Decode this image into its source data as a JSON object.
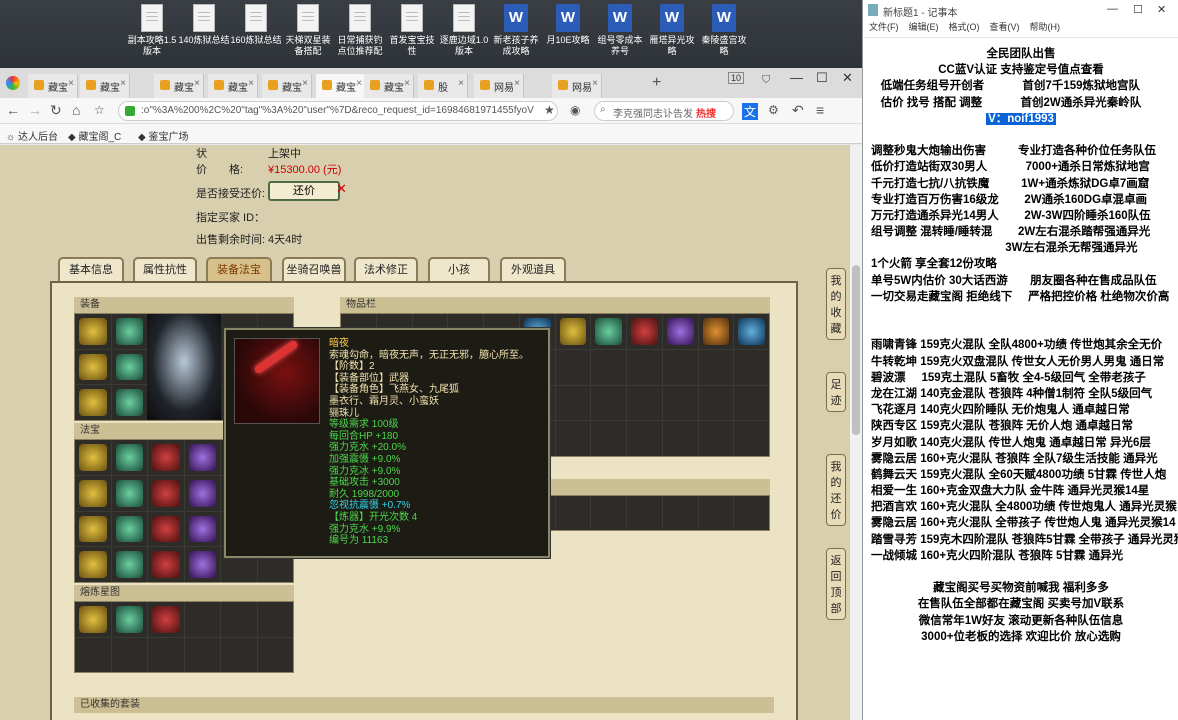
{
  "desktop_icons": [
    {
      "label": "副本攻略1.5\n版本",
      "type": "doc"
    },
    {
      "label": "140炼狱总结",
      "type": "doc"
    },
    {
      "label": "160炼狱总结",
      "type": "doc"
    },
    {
      "label": "天梯双星装\n备搭配",
      "type": "doc"
    },
    {
      "label": "日常捕获钓\n点位推荐配",
      "type": "doc"
    },
    {
      "label": "首发宝宝技\n性",
      "type": "doc"
    },
    {
      "label": "逐鹿边域1.0\n版本",
      "type": "doc"
    },
    {
      "label": "新老孩子养\n成攻略",
      "type": "word"
    },
    {
      "label": "月10E攻略",
      "type": "word"
    },
    {
      "label": "组号零成本\n养号",
      "type": "word"
    },
    {
      "label": "雁塔异光攻\n略",
      "type": "word"
    },
    {
      "label": "秦陵盛宫攻\n略",
      "type": "word"
    }
  ],
  "browser": {
    "tabs": [
      {
        "label": "藏宝"
      },
      {
        "label": "藏宝"
      },
      {
        "label": "藏宝"
      },
      {
        "label": "藏宝"
      },
      {
        "label": "藏宝"
      },
      {
        "label": "藏宝",
        "active": true
      },
      {
        "label": "藏宝"
      },
      {
        "label": "股"
      },
      {
        "label": "网易"
      },
      {
        "label": "网易"
      }
    ],
    "tab_count": "10",
    "url": ":o\"%3A%200%2C%20\"tag\"%3A%20\"user\"%7D&reco_request_id=16984681971455fyoV",
    "search_placeholder": "李克强同志讣告发",
    "search_hot": "热搜",
    "bookmarks": [
      "达人后台",
      "藏宝阁_C",
      "鉴宝广场"
    ]
  },
  "item_info": {
    "status_label": "状",
    "status_value": "上架中",
    "price_label": "价　　格:",
    "price_value": "¥15300.00 (元)",
    "counteroffer_label": "是否接受还价:",
    "counteroffer_button": "还价",
    "buyer_label": "指定买家 ID：",
    "remaining_label": "出售剩余时间:",
    "remaining_value": "4天4时"
  },
  "nav_tabs": [
    {
      "label": "基本信息"
    },
    {
      "label": "属性抗性"
    },
    {
      "label": "装备法宝",
      "active": true
    },
    {
      "label": "坐骑召唤兽"
    },
    {
      "label": "法术修正"
    },
    {
      "label": "小孩"
    },
    {
      "label": "外观道具"
    }
  ],
  "sections": {
    "equipment": "装备",
    "treasure": "法宝",
    "talisman": "熔炼星图",
    "inventory": "物品栏",
    "collected": "已收集的套装"
  },
  "side_buttons": [
    "我的收藏",
    "足迹",
    "我的还价",
    "返回顶部"
  ],
  "tooltip": {
    "lines": [
      {
        "text": "暗夜",
        "color": "yellow"
      },
      {
        "text": "索魂勾命，暗夜无声，无正无邪，臆心所至。",
        "color": "white"
      },
      {
        "text": "【阶数】2",
        "color": "white"
      },
      {
        "text": "【装备部位】武器",
        "color": "white"
      },
      {
        "text": "【装备角色】飞燕女、九尾狐",
        "color": "white"
      },
      {
        "text": "墨衣行、霜月灵、小蛮妖",
        "color": "white"
      },
      {
        "text": "骊珠儿",
        "color": "white"
      },
      {
        "text": "等级需求 100级",
        "color": "green"
      },
      {
        "text": "每回合HP +180",
        "color": "green"
      },
      {
        "text": "强力克水 +20.0%",
        "color": "green"
      },
      {
        "text": "加强震慑 +9.0%",
        "color": "green"
      },
      {
        "text": "强力克冰 +9.0%",
        "color": "green"
      },
      {
        "text": "基础攻击 +3000",
        "color": "green"
      },
      {
        "text": "耐久 1998/2000",
        "color": "green"
      },
      {
        "text": "忽视抗震慑 +0.7%",
        "color": "cyan"
      },
      {
        "text": " ",
        "color": "white"
      },
      {
        "text": "【炼器】开光次数 4",
        "color": "green"
      },
      {
        "text": "强力克水 +9.9%",
        "color": "green"
      },
      {
        "text": " ",
        "color": "white"
      },
      {
        "text": "编号为 11163",
        "color": "green"
      }
    ]
  },
  "notepad": {
    "title": "新标题1 - 记事本",
    "menu": [
      "文件(F)",
      "编辑(E)",
      "格式(O)",
      "查看(V)",
      "帮助(H)"
    ],
    "lines": [
      {
        "text": "全民团队出售",
        "center": true
      },
      {
        "text": "CC蓝V认证 支持鉴定号值点查看",
        "center": true
      },
      {
        "text": "   低端任务组号开创者            首创7千159炼狱地宫队"
      },
      {
        "text": "   估价 找号 搭配 调整            首创2W通杀异光秦岭队"
      },
      {
        "text": "V：noif1993",
        "center": true,
        "selected": true
      },
      {
        "text": " "
      },
      {
        "text": "调整秒鬼大炮输出伤害          专业打造各种价位任务队伍"
      },
      {
        "text": "低价打造站街双30男人            7000+通杀日常炼狱地宫"
      },
      {
        "text": "千元打造七抗/八抗铁魔          1W+通杀炼狱DG卓7画窟"
      },
      {
        "text": "专业打造百万伤害16级龙        2W通杀160DG卓混卓画"
      },
      {
        "text": "万元打造通杀异光14男人        2W-3W四阶睡杀160队伍"
      },
      {
        "text": "组号调整 混转睡/睡转混        2W左右混杀踏帮强通异光"
      },
      {
        "text": "                                          3W左右混杀无帮强通异光"
      },
      {
        "text": "1个火箭 享全套12份攻略"
      },
      {
        "text": "单号5W内估价 30大话西游       朋友圈各种在售成品队伍"
      },
      {
        "text": "一切交易走藏宝阁 拒绝线下     严格把控价格 杜绝物次价高"
      },
      {
        "text": " "
      },
      {
        "text": " "
      },
      {
        "text": "雨啸青锋 159克火混队 全队4800+功绩 传世炮其余全无价"
      },
      {
        "text": "牛转乾坤 159克火双盘混队 传世女人无价男人男鬼 通日常"
      },
      {
        "text": "碧波漂     159克土混队 5畜牧 全4-5级回气 全带老孩子"
      },
      {
        "text": "龙在江湖 140克金混队 苍狼阵 4种僧1制符 全队5级回气"
      },
      {
        "text": "飞花逐月 140克火四阶睡队 无价炮鬼人 通卓越日常"
      },
      {
        "text": "陕西专区 159克火混队 苍狼阵 无价人炮 通卓越日常"
      },
      {
        "text": "岁月如歌 140克火混队 传世人炮鬼 通卓越日常 异光6层"
      },
      {
        "text": "雾隐云居 160+克火混队 苍狼阵 全队7级生活技能 通异光"
      },
      {
        "text": "鹤舞云天 159克火混队 全60天赋4800功绩 5甘霖 传世人炮"
      },
      {
        "text": "相爱一生 160+克金双盘大力队 金牛阵 通异光灵猴14星"
      },
      {
        "text": "把酒言欢 160+克火混队 全4800功绩 传世炮鬼人 通异光灵猴"
      },
      {
        "text": "雾隐云居 160+克火混队 全带孩子 传世炮人鬼 通异光灵猴14"
      },
      {
        "text": "踏雪寻芳 159克木四阶混队 苍狼阵5甘霖 全带孩子 通异光灵猴"
      },
      {
        "text": "一战倾城 160+克火四阶混队 苍狼阵 5甘霖 通异光"
      },
      {
        "text": " "
      },
      {
        "text": "藏宝阁买号买物资前喊我 福利多多",
        "center": true
      },
      {
        "text": "在售队伍全部都在藏宝阁 买卖号加V联系",
        "center": true
      },
      {
        "text": "微信常年1W好友 滚动更新各种队伍信息",
        "center": true
      },
      {
        "text": "3000+位老板的选择 欢迎比价 放心选购",
        "center": true
      }
    ]
  }
}
